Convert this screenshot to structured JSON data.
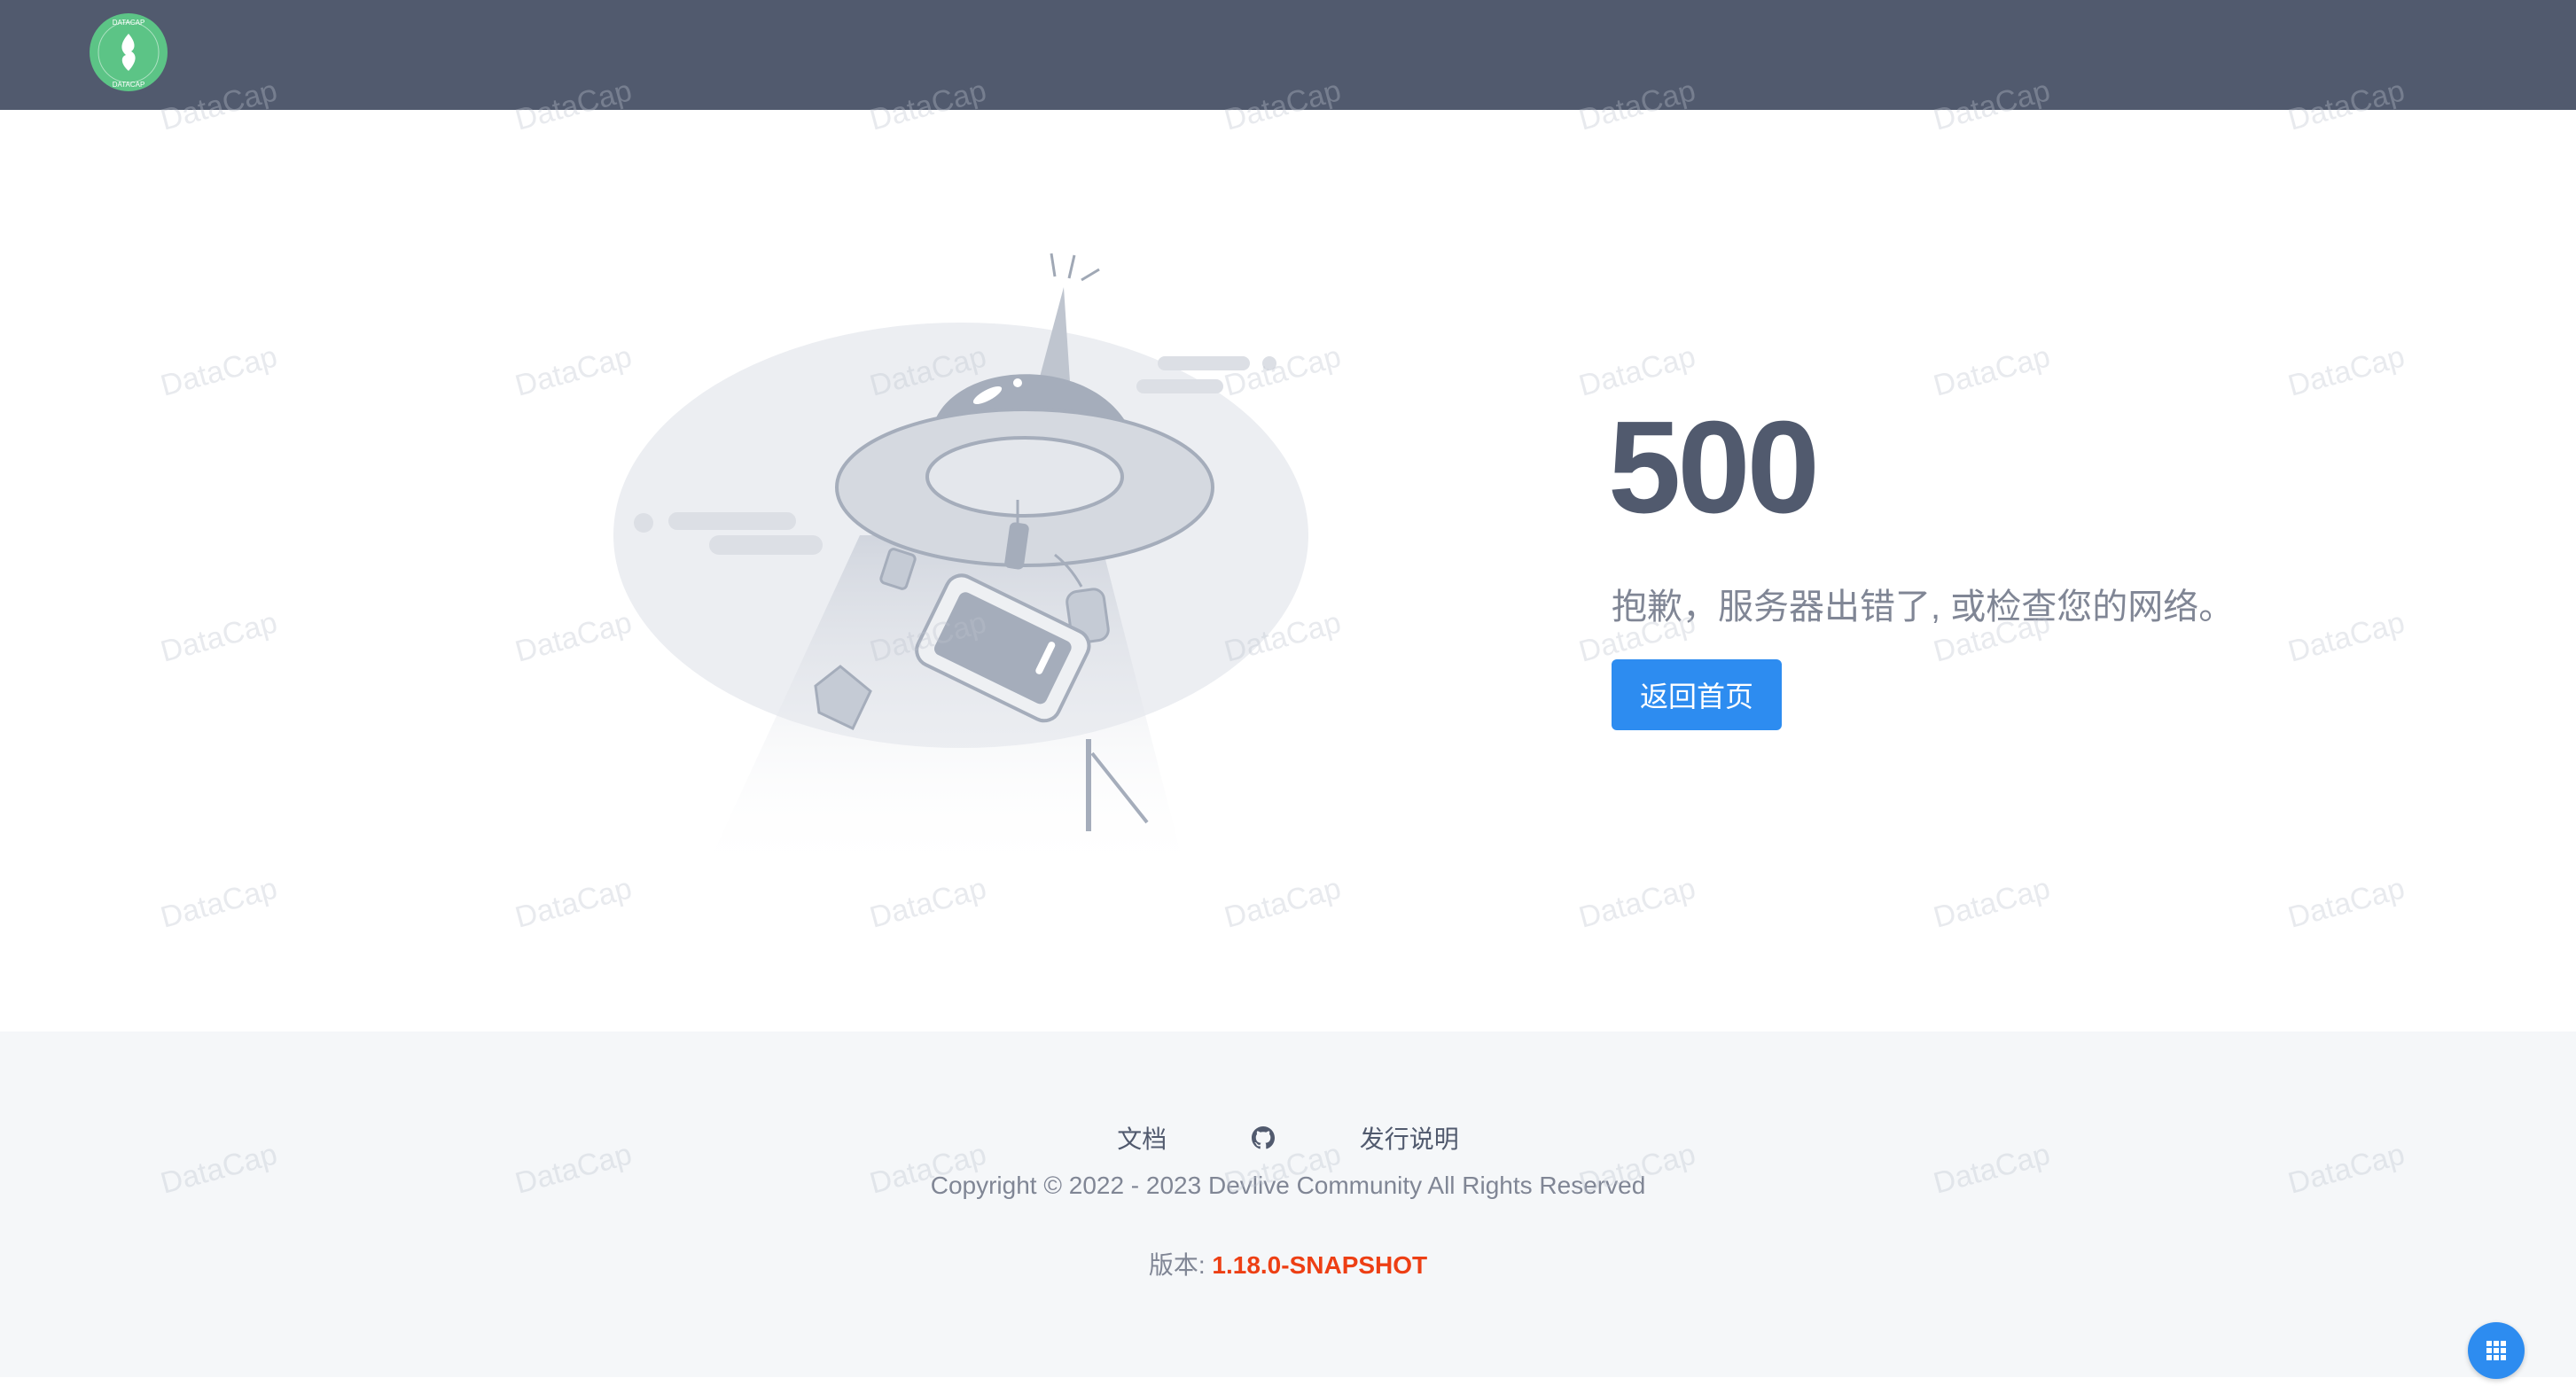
{
  "header": {
    "logo_text": "DATACAP"
  },
  "error": {
    "code": "500",
    "message": "抱歉，服务器出错了, 或检查您的网络。",
    "button_label": "返回首页"
  },
  "footer": {
    "links": {
      "docs": "文档",
      "github_icon": "github-icon",
      "release_notes": "发行说明"
    },
    "copyright": "Copyright © 2022 - 2023 Devlive Community All Rights Reserved",
    "version_label": "版本: ",
    "version_value": "1.18.0-SNAPSHOT"
  },
  "watermark_text": "DataCap",
  "colors": {
    "header_bg": "#515a6e",
    "accent": "#2d8cf0",
    "logo_green": "#5cc486",
    "version_red": "#ed3f14"
  }
}
